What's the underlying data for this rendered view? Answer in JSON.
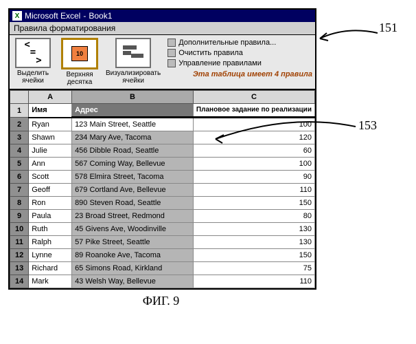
{
  "window": {
    "app": "Microsoft Excel",
    "doc": "Book1"
  },
  "ribbonTab": "Правила форматирования",
  "toolbar": {
    "highlight": {
      "label": "Выделить\nячейки"
    },
    "top10": {
      "label": "Верхняя\nдесятка",
      "badge": "10"
    },
    "visualize": {
      "label": "Визуализировать\nячейки"
    }
  },
  "rules": {
    "items": [
      "Дополнительные правила...",
      "Очистить правила",
      "Управление правилами"
    ],
    "status": "Эта таблица имеет 4 правила"
  },
  "columns": {
    "A": "A",
    "B": "B",
    "C": "C"
  },
  "headerRow": {
    "a": "Имя",
    "b": "Адрес",
    "c": "Плановое задание по реализации"
  },
  "rows": [
    {
      "n": "2",
      "a": "Ryan",
      "b": "123 Main Street, Seattle",
      "c": "100"
    },
    {
      "n": "3",
      "a": "Shawn",
      "b": "234 Mary Ave, Tacoma",
      "c": "120"
    },
    {
      "n": "4",
      "a": "Julie",
      "b": "456 Dibble Road, Seattle",
      "c": "60"
    },
    {
      "n": "5",
      "a": "Ann",
      "b": "567 Coming Way, Bellevue",
      "c": "100"
    },
    {
      "n": "6",
      "a": "Scott",
      "b": "578 Elmira Street, Tacoma",
      "c": "90"
    },
    {
      "n": "7",
      "a": "Geoff",
      "b": "679 Cortland Ave, Bellevue",
      "c": "110"
    },
    {
      "n": "8",
      "a": "Ron",
      "b": "890 Steven Road, Seattle",
      "c": "150"
    },
    {
      "n": "9",
      "a": "Paula",
      "b": "23 Broad Street, Redmond",
      "c": "80"
    },
    {
      "n": "10",
      "a": "Ruth",
      "b": "45 Givens Ave, Woodinville",
      "c": "130"
    },
    {
      "n": "11",
      "a": "Ralph",
      "b": "57 Pike Street, Seattle",
      "c": "130"
    },
    {
      "n": "12",
      "a": "Lynne",
      "b": "89 Roanoke Ave, Tacoma",
      "c": "150"
    },
    {
      "n": "13",
      "a": "Richard",
      "b": "65 Simons Road, Kirkland",
      "c": "75"
    },
    {
      "n": "14",
      "a": "Mark",
      "b": "43 Welsh Way, Bellevue",
      "c": "110"
    }
  ],
  "annotations": {
    "a151": "151",
    "a153": "153"
  },
  "figure": "ФИГ. 9"
}
